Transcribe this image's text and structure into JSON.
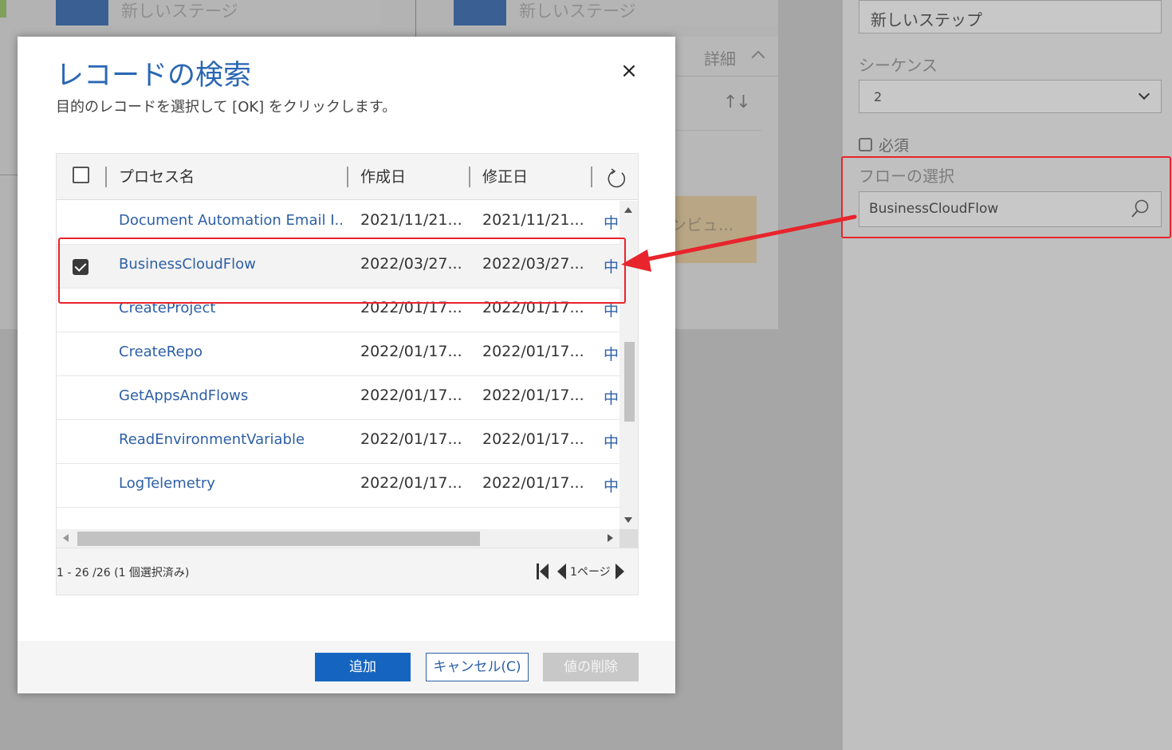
{
  "background": {
    "stage1_label": "新しいステージ",
    "stage2_label": "新しいステージ",
    "details_label": "詳細",
    "sort_arrows": "↑↓",
    "tile_text": "ンビュ..."
  },
  "right_panel": {
    "step_name_value": "新しいステップ",
    "sequence_label": "シーケンス",
    "sequence_value": "2",
    "required_label": "必須",
    "flow_select_label": "フローの選択",
    "flow_value": "BusinessCloudFlow"
  },
  "dialog": {
    "title": "レコードの検索",
    "close_glyph": "×",
    "subtitle": "目的のレコードを選択して [OK] をクリックします。",
    "columns": [
      "プロセス名",
      "作成日",
      "修正日"
    ],
    "rows": [
      {
        "name": "Document Automation Email I...",
        "created": "2021/11/21...",
        "modified": "2021/11/21...",
        "status": "中",
        "selected": false
      },
      {
        "name": "BusinessCloudFlow",
        "created": "2022/03/27...",
        "modified": "2022/03/27...",
        "status": "中",
        "selected": true
      },
      {
        "name": "CreateProject",
        "created": "2022/01/17...",
        "modified": "2022/01/17...",
        "status": "中",
        "selected": false
      },
      {
        "name": "CreateRepo",
        "created": "2022/01/17...",
        "modified": "2022/01/17...",
        "status": "中",
        "selected": false
      },
      {
        "name": "GetAppsAndFlows",
        "created": "2022/01/17...",
        "modified": "2022/01/17...",
        "status": "中",
        "selected": false
      },
      {
        "name": "ReadEnvironmentVariable",
        "created": "2022/01/17...",
        "modified": "2022/01/17...",
        "status": "中",
        "selected": false
      },
      {
        "name": "LogTelemetry",
        "created": "2022/01/17...",
        "modified": "2022/01/17...",
        "status": "中",
        "selected": false
      }
    ],
    "record_count": "1 - 26 /26 (1 個選択済み)",
    "page_label": "1ページ",
    "buttons": {
      "add": "追加",
      "cancel": "キャンセル(C)",
      "delete": "値の削除"
    }
  },
  "colors": {
    "accent": "#1565c0",
    "link": "#2d5fa6",
    "annotation": "#e8242c"
  },
  "icons": [
    "close-icon",
    "refresh-icon",
    "search-icon",
    "chevron-down-icon",
    "first-page-icon",
    "prev-page-icon",
    "next-page-icon"
  ]
}
